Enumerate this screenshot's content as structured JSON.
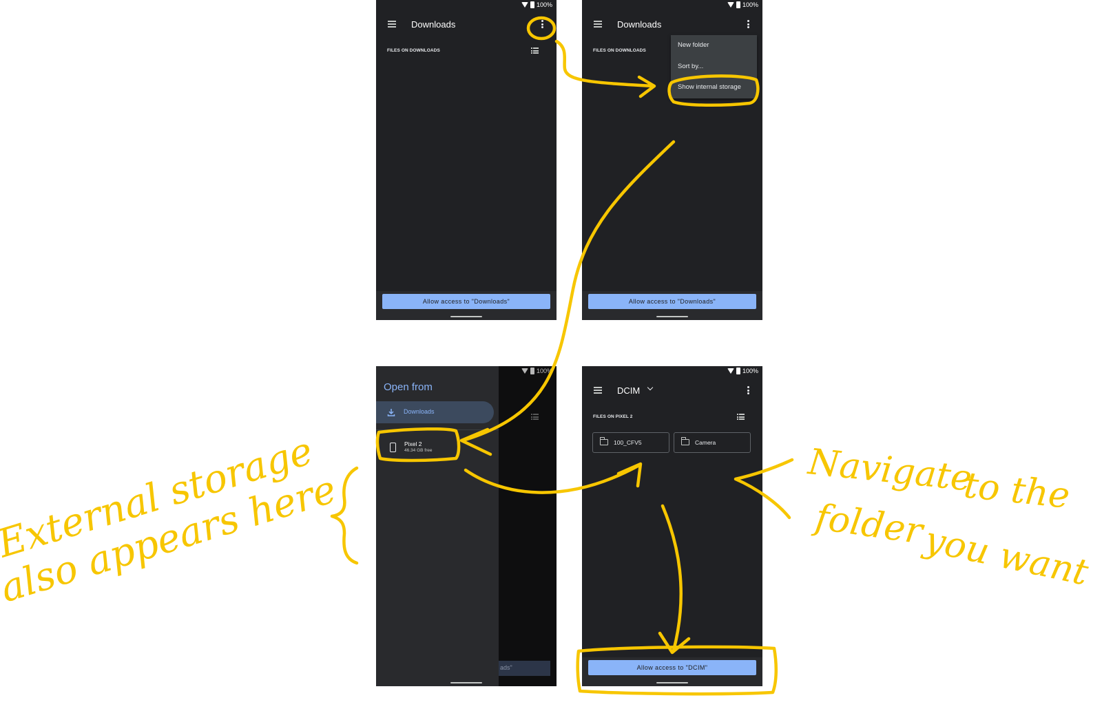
{
  "status_bar": {
    "battery": "100%"
  },
  "panel1": {
    "title": "Downloads",
    "section_label": "FILES ON DOWNLOADS",
    "allow_button": "Allow access to \"Downloads\""
  },
  "panel2": {
    "title": "Downloads",
    "section_label": "FILES ON DOWNLOADS",
    "menu_items": [
      "New folder",
      "Sort by...",
      "Show internal storage"
    ],
    "allow_button": "Allow access to \"Downloads\""
  },
  "panel3": {
    "drawer_title": "Open from",
    "downloads_label": "Downloads",
    "device_name": "Pixel 2",
    "device_free": "46.34 GB free",
    "background_button_fragment": "ads\""
  },
  "panel4": {
    "title": "DCIM",
    "section_label": "FILES ON PIXEL 2",
    "folders": [
      "100_CFV5",
      "Camera"
    ],
    "allow_button": "Allow access to \"DCIM\""
  },
  "annotations": {
    "left_line1": "External storage",
    "left_line2": "also appears here",
    "right_line1": "Navigate",
    "right_line2": "to the",
    "right_line3": "folder",
    "right_line4": "you want",
    "color": "#f7c600"
  }
}
